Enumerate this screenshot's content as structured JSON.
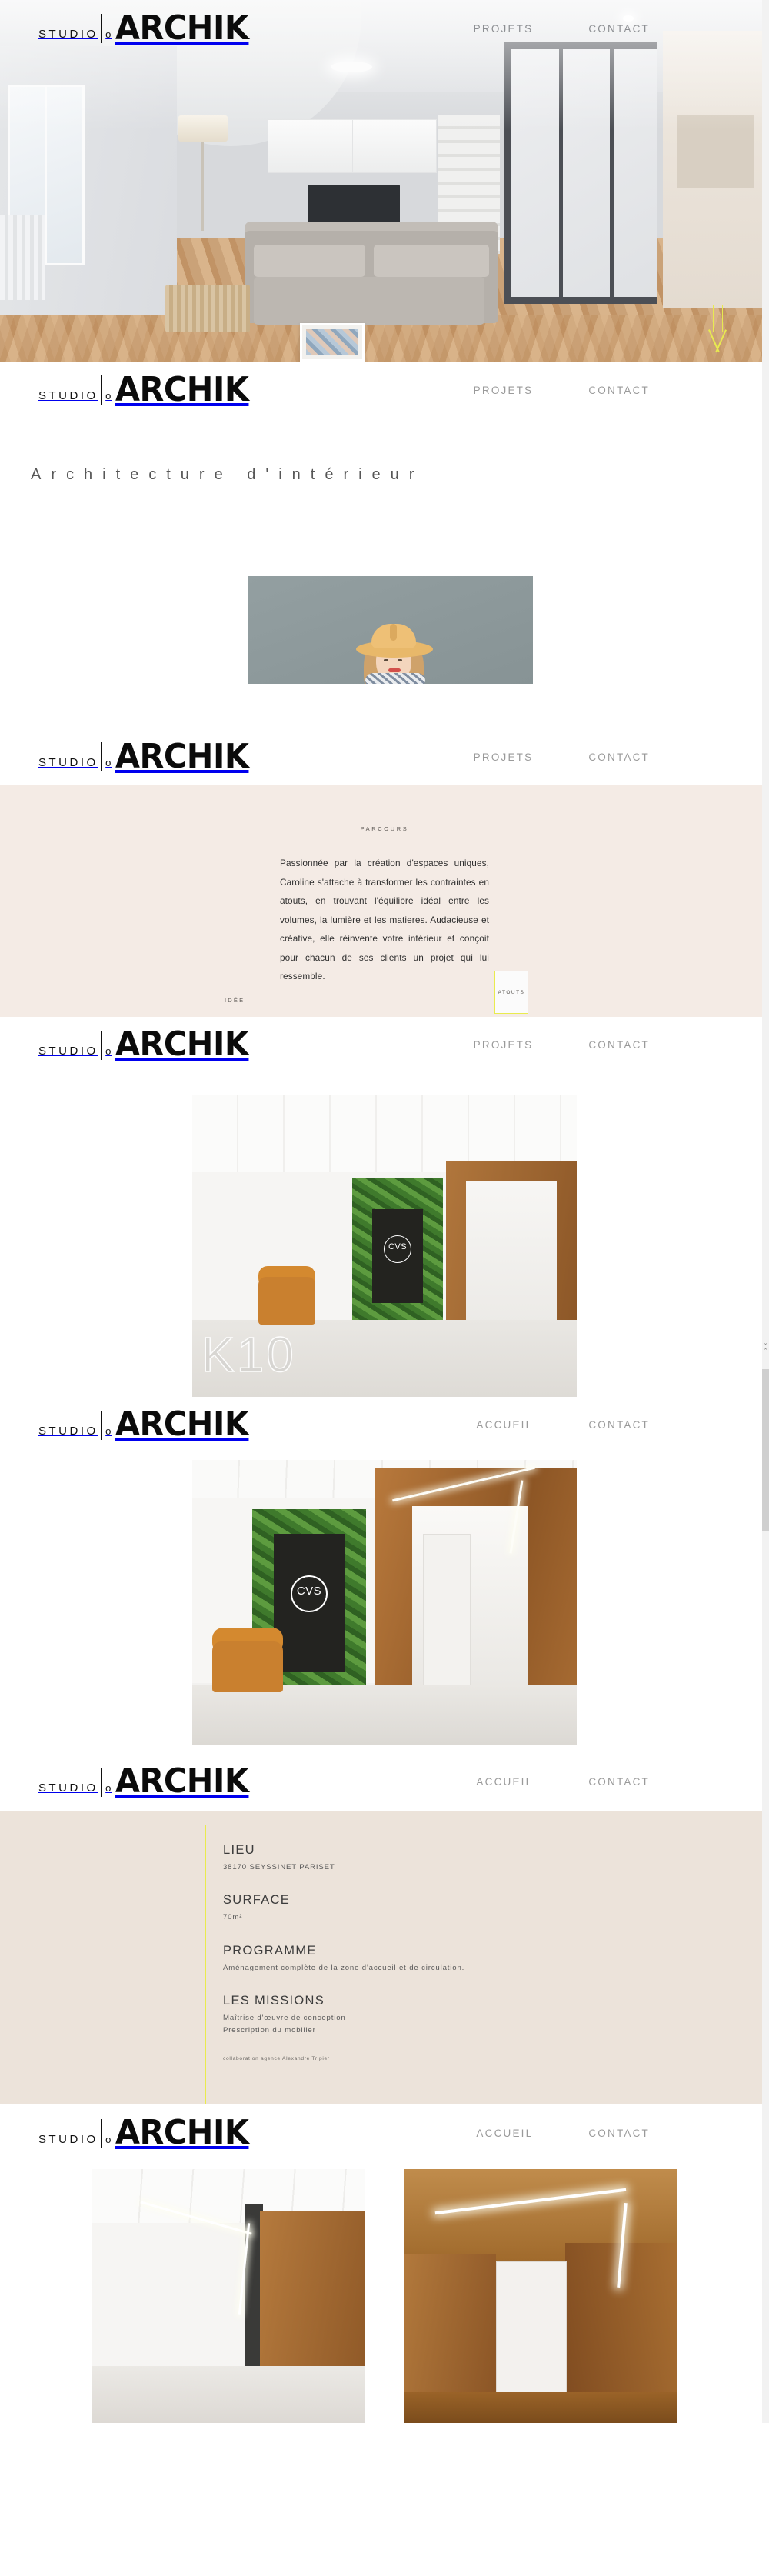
{
  "brand": {
    "studio": "STUDIO",
    "separator_o": "o",
    "archik": "ARCHIK"
  },
  "nav_main": {
    "projets": "PROJETS",
    "contact": "CONTACT"
  },
  "nav_project": {
    "accueil": "ACCUEIL",
    "contact": "CONTACT"
  },
  "hero": {
    "scroll_indicator": "scroll-down-arrow",
    "accent_color": "#e8ea50"
  },
  "intro": {
    "heading": "Architecture    d'intérieur"
  },
  "about": {
    "label_top": "PARCOURS",
    "label_left": "IDÉE",
    "badge": "ATOUTS",
    "paragraph": "Passionnée par la création d'espaces uniques, Caroline s'attache à transformer les contraintes en atouts, en trouvant l'équilibre idéal entre les volumes, la lumière et les matieres. Audacieuse et créative, elle réinvente votre intérieur et conçoit pour chacun de ses clients un projet qui lui ressemble.",
    "background_color": "#f4ebe5"
  },
  "project": {
    "title": "K10",
    "logo_on_wall": "CVS",
    "details": [
      {
        "heading": "LIEU",
        "lines": "38170 SEYSSINET PARISET"
      },
      {
        "heading": "SURFACE",
        "lines": "70m²"
      },
      {
        "heading": "PROGRAMME",
        "lines": "Aménagement complète de la zone d'accueil et de circulation."
      },
      {
        "heading": "LES MISSIONS",
        "lines": "Maîtrise d'œuvre de conception\nPrescription du mobilier"
      }
    ],
    "credit": "collaboration agence Alexandre Tripier",
    "details_background": "#ece3da",
    "rule_color": "#e9eb4e"
  },
  "scrollbar": {
    "up_arrow": "⌃",
    "down_arrow": "⌄"
  }
}
